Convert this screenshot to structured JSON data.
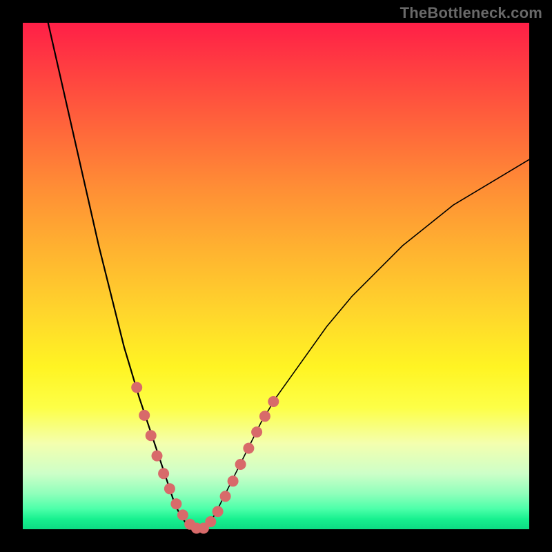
{
  "watermark": {
    "text": "TheBottleneck.com"
  },
  "colors": {
    "background": "#000000",
    "curve": "#000000",
    "dots": "#d86a6a",
    "gradient_top": "#ff1f47",
    "gradient_bottom": "#0ddc83"
  },
  "chart_data": {
    "type": "line",
    "title": "",
    "xlabel": "",
    "ylabel": "",
    "xlim": [
      0,
      100
    ],
    "ylim": [
      0,
      100
    ],
    "grid": false,
    "legend": false,
    "description": "V-shaped bottleneck curve over vertical rainbow gradient; minimum near x≈34, curve height encodes bottleneck percentage (0 at green bottom, 100 at red top).",
    "series": [
      {
        "name": "bottleneck-curve",
        "x": [
          5,
          10,
          15,
          20,
          23,
          25,
          27,
          29,
          30,
          31,
          32,
          33,
          34,
          35,
          36,
          37,
          38,
          40,
          42,
          44,
          47,
          50,
          55,
          60,
          65,
          70,
          75,
          80,
          85,
          90,
          95,
          100
        ],
        "values": [
          100,
          78,
          56,
          36,
          26,
          20,
          14,
          8,
          5,
          3,
          1.5,
          0.5,
          0,
          0,
          0.5,
          1.5,
          3,
          7,
          11,
          15,
          21,
          26,
          33,
          40,
          46,
          51,
          56,
          60,
          64,
          67,
          70,
          73
        ]
      }
    ],
    "markers": {
      "name": "highlighted-points",
      "x": [
        22.5,
        24.0,
        25.3,
        26.5,
        27.8,
        29.0,
        30.3,
        31.6,
        33.0,
        34.3,
        35.7,
        37.1,
        38.5,
        40.0,
        41.5,
        43.0,
        44.6,
        46.2,
        47.8,
        49.5
      ],
      "values": [
        28.0,
        22.5,
        18.5,
        14.5,
        11.0,
        8.0,
        5.0,
        2.8,
        1.0,
        0.2,
        0.2,
        1.5,
        3.5,
        6.5,
        9.5,
        12.8,
        16.0,
        19.2,
        22.3,
        25.2
      ]
    }
  }
}
